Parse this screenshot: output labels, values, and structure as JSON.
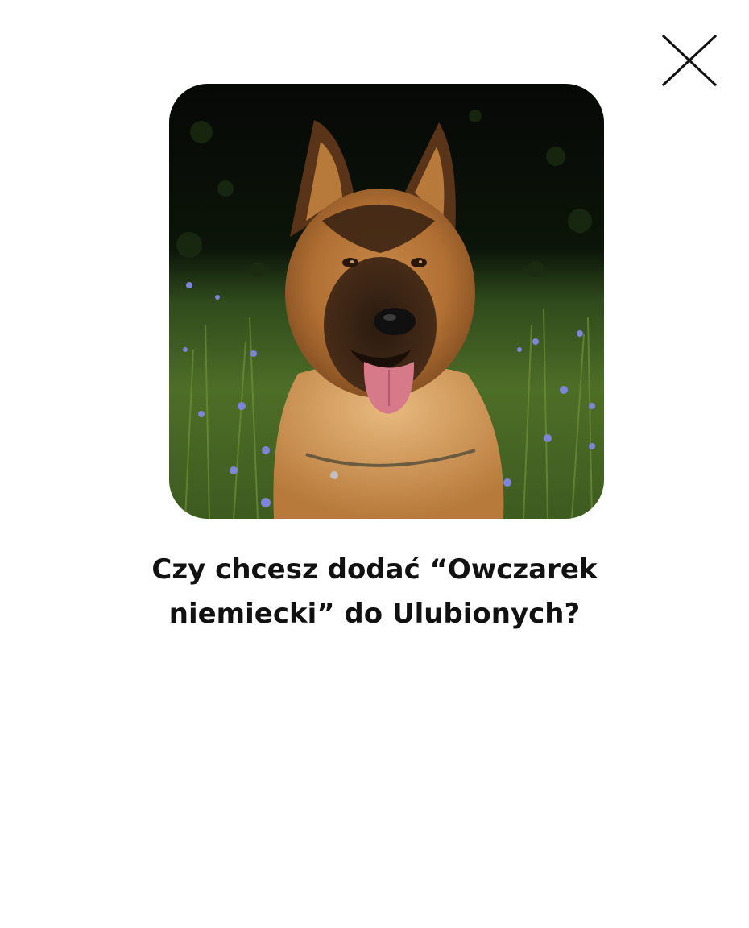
{
  "dialog": {
    "close_icon": "close-icon",
    "photo_subject": "German shepherd dog sitting in a meadow with blue cornflowers",
    "question": "Czy chcesz dodać “Owczarek niemiecki” do Ulubionych?"
  },
  "colors": {
    "background": "#ffffff",
    "text": "#111111",
    "close_icon": "#111111"
  }
}
